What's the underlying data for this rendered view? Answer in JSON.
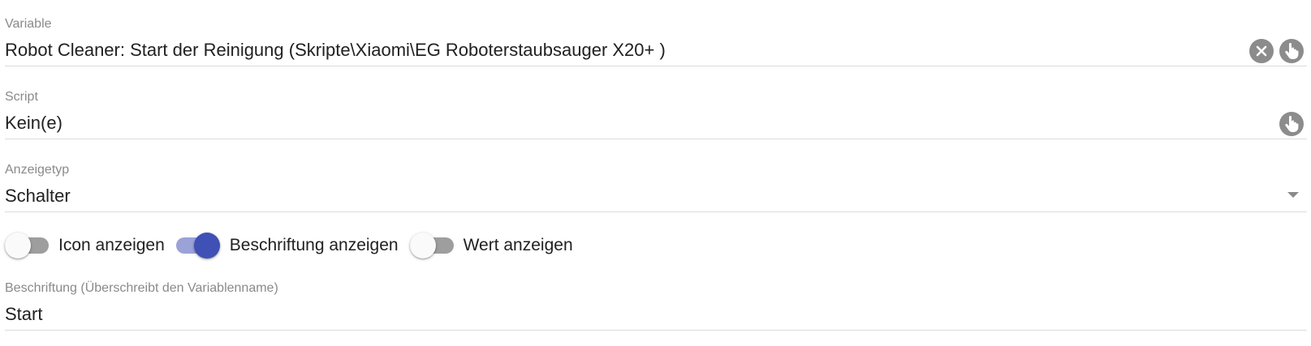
{
  "variable": {
    "label": "Variable",
    "value": "Robot Cleaner: Start der  Reinigung (Skripte\\Xiaomi\\EG Roboterstaubsauger X20+ )",
    "clear_icon": "close-icon",
    "select_icon": "hand-pointer-icon"
  },
  "script": {
    "label": "Script",
    "value": "Kein(e)",
    "select_icon": "hand-pointer-icon"
  },
  "display_type": {
    "label": "Anzeigetyp",
    "value": "Schalter",
    "dropdown_icon": "chevron-down-icon"
  },
  "toggles": [
    {
      "label": "Icon anzeigen",
      "checked": false
    },
    {
      "label": "Beschriftung anzeigen",
      "checked": true
    },
    {
      "label": "Wert anzeigen",
      "checked": false
    }
  ],
  "caption": {
    "label": "Beschriftung (Überschreibt den Variablenname)",
    "value": "Start"
  },
  "colors": {
    "accent": "#3f51b5",
    "accent_track": "#9aa2d8",
    "icon_gray": "#8c8c8c",
    "label_gray": "#8a8a8a",
    "divider": "#dcdcdc"
  }
}
